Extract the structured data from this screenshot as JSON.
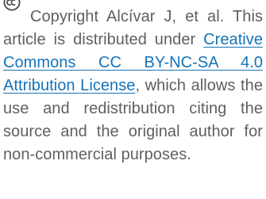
{
  "notice": {
    "icon": "creative-commons-icon",
    "copyright": "Copyright Alcívar J, et al.",
    "text_before_link": "This article is distributed under",
    "link_text": "Creative Commons CC BY-NC-SA 4.0 Attribution License",
    "text_after_link": ", which allows the use and redistribution citing the source and the original author for non-commercial purposes."
  },
  "colors": {
    "text": "#5f5f5f",
    "link": "#1473b8"
  }
}
